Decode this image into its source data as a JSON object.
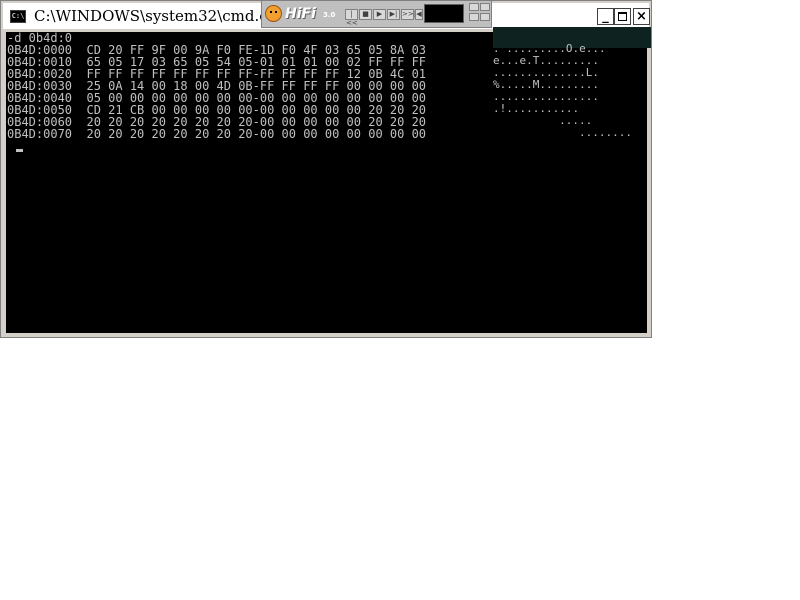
{
  "window": {
    "icon_text": "C:\\",
    "title": "C:\\WINDOWS\\system32\\cmd.exe -",
    "buttons": {
      "minimize": "_",
      "close": "×"
    }
  },
  "console": {
    "command": "-d 0b4d:0",
    "lines": [
      "0B4D:0000  CD 20 FF 9F 00 9A F0 FE-1D F0 4F 03 65 05 8A 03",
      "0B4D:0010  65 05 17 03 65 05 54 05-01 01 01 00 02 FF FF FF",
      "0B4D:0020  FF FF FF FF FF FF FF FF-FF FF FF FF 12 0B 4C 01",
      "0B4D:0030  25 0A 14 00 18 00 4D 0B-FF FF FF FF 00 00 00 00",
      "0B4D:0040  05 00 00 00 00 00 00 00-00 00 00 00 00 00 00 00",
      "0B4D:0050  CD 21 CB 00 00 00 00 00-00 00 00 00 00 20 20 20",
      "0B4D:0060  20 20 20 20 20 20 20 20-00 00 00 00 00 20 20 20",
      "0B4D:0070  20 20 20 20 20 20 20 20-00 00 00 00 00 00 00 00"
    ],
    "ascii": [
      ". .........O.e...",
      "e...e.T.........",
      "..............L.",
      "%.....M.........",
      "................",
      ".!...........",
      "     .....",
      "        ........"
    ]
  },
  "player": {
    "logo": "HiFi",
    "sub_logo": "3.0",
    "controls": [
      "|<<",
      "■",
      "▶",
      "▶|",
      ">>|",
      "◀"
    ]
  }
}
